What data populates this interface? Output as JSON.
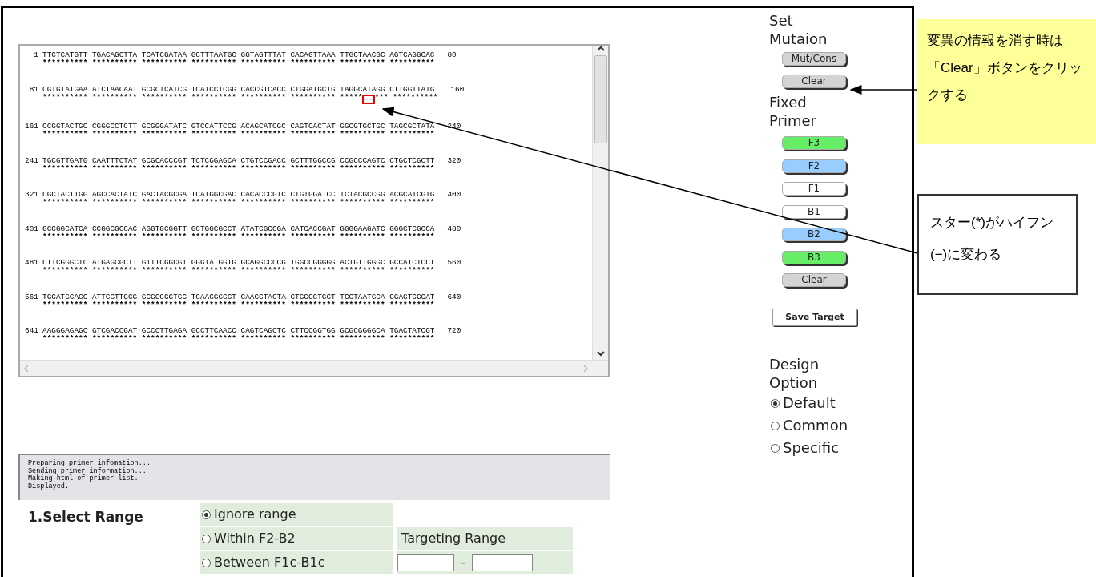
{
  "sequence_view": {
    "rows": [
      {
        "start": "1",
        "bases": "TTCTCATGTT TGACAGCTTA TCATCGATAA GCTTTAATGC GGTAGTTTAT CACAGTTAAA TTGCTAACGC AGTCAGGCAC",
        "marks": "********** ********** ********** ********** ********** ********** ********** **********",
        "end": "80"
      },
      {
        "start": "81",
        "bases": "CGTGTATGAA ATCTAACAAT GCGCTCATCG TCATCCTCGG CACCGTCACC CTGGATGCTG TAGGCATAGG CTTGGTTATG",
        "marks": "********** ********** ********** ********** ********** ********** *****--*** **********",
        "end": "160"
      },
      {
        "start": "161",
        "bases": "CCGGTACTGC CGGGCCTCTT GCGGGATATC GTCCATTCCG ACAGCATCGC CAGTCACTAT GGCGTGCTGC TAGCGCTATA",
        "marks": "********** ********** ********** ********** ********** ********** ********** **********",
        "end": "240"
      },
      {
        "start": "241",
        "bases": "TGCGTTGATG CAATTTCTAT GCGCACCCGT TCTCGGAGCA CTGTCCGACC GCTTTGGCCG CCGCCCAGTC CTGCTCGCTT",
        "marks": "********** ********** ********** ********** ********** ********** ********** **********",
        "end": "320"
      },
      {
        "start": "321",
        "bases": "CGCTACTTGG AGCCACTATC GACTACGCGA TCATGGCGAC CACACCCGTC CTGTGGATCC TCTACGCCGG ACGCATCGTG",
        "marks": "********** ********** ********** ********** ********** ********** ********** **********",
        "end": "400"
      },
      {
        "start": "401",
        "bases": "GCCGGCATCA CCGGCGCCAC AGGTGCGGTT GCTGGCGCCT ATATCGCCGA CATCACCGAT GGGGAAGATC GGGCTCGCCA",
        "marks": "********** ********** ********** ********** ********** ********** ********** **********",
        "end": "480"
      },
      {
        "start": "481",
        "bases": "CTTCGGGCTC ATGAGCGCTT GTTTCGGCGT GGGTATGGTG GCAGGCCCCG TGGCCGGGGG ACTGTTGGGC GCCATCTCCT",
        "marks": "********** ********** ********** ********** ********** ********** ********** **********",
        "end": "560"
      },
      {
        "start": "561",
        "bases": "TGCATGCACC ATTCCTTGCG GCGGCGGTGC TCAACGGCCT CAACCTACTA CTGGGCTGCT TCCTAATGCA GGAGTCGCAT",
        "marks": "********** ********** ********** ********** ********** ********** ********** **********",
        "end": "640"
      },
      {
        "start": "641",
        "bases": "AAGGGAGAGC GTCGACCGAT GCCCTTGAGA GCCTTCAACC CAGTCAGCTC CTTCCGGTGG GCGCGGGGCA TGACTATCGT",
        "marks": "********** ********** ********** ********** ********** ********** ********** **********",
        "end": "720"
      }
    ]
  },
  "status_log": [
    "Preparing primer infomation...",
    "Sending primer information...",
    "Making html of primer list.",
    "Displayed."
  ],
  "select_range": {
    "title": "1.Select Range",
    "options": [
      {
        "label": "Ignore range",
        "selected": true
      },
      {
        "label": "Within F2-B2",
        "selected": false
      },
      {
        "label": "Between F1c-B1c",
        "selected": false
      }
    ],
    "targeting_label": "Targeting Range",
    "separator": "-"
  },
  "side_panel": {
    "set_mutation": {
      "title_lines": [
        "Set",
        "Mutaion"
      ],
      "buttons": [
        {
          "label": "Mut/Cons",
          "color": "#d4d4d4"
        },
        {
          "label": "Clear",
          "color": "#d4d4d4"
        }
      ]
    },
    "fixed_primer": {
      "title_lines": [
        "Fixed",
        "Primer"
      ],
      "buttons": [
        {
          "label": "F3",
          "color": "#66ee66"
        },
        {
          "label": "F2",
          "color": "#99ccff"
        },
        {
          "label": "F1",
          "color": "#ffffff"
        },
        {
          "label": "B1",
          "color": "#ffffff"
        },
        {
          "label": "B2",
          "color": "#99ccff"
        },
        {
          "label": "B3",
          "color": "#66ee66"
        },
        {
          "label": "Clear",
          "color": "#d4d4d4"
        }
      ]
    },
    "save_button": "Save Target",
    "design_option": {
      "title_lines": [
        "Design",
        "Option"
      ],
      "options": [
        {
          "label": "Default",
          "selected": true
        },
        {
          "label": "Common",
          "selected": false
        },
        {
          "label": "Specific",
          "selected": false
        }
      ]
    }
  },
  "annotations": [
    {
      "kind": "note",
      "text": "変異の情報を消す時は「Clear」ボタンをクリックする"
    },
    {
      "kind": "callout",
      "text": "スター(*)がハイフン(−)に変わる"
    }
  ]
}
